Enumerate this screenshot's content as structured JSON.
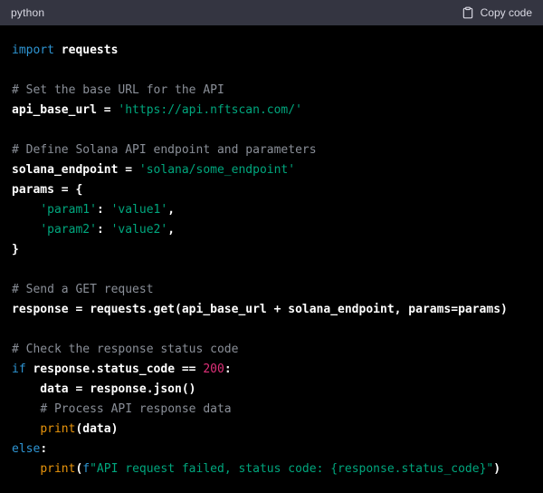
{
  "header": {
    "language": "python",
    "copy_label": "Copy code",
    "copy_icon": "clipboard-icon"
  },
  "colors": {
    "header_bg": "#343541",
    "header_fg": "#d9d9e3",
    "code_bg": "#000000",
    "plain": "#ffffff",
    "keyword": "#2e95d3",
    "string": "#00a67d",
    "number": "#df3079",
    "builtin": "#e9950c",
    "comment": "#8a8f98"
  },
  "code": {
    "lines": [
      [
        {
          "t": "kw",
          "v": "import"
        },
        {
          "t": "p",
          "v": " requests"
        }
      ],
      [],
      [
        {
          "t": "com",
          "v": "# Set the base URL for the API"
        }
      ],
      [
        {
          "t": "p",
          "v": "api_base_url = "
        },
        {
          "t": "str",
          "v": "'https://api.nftscan.com/'"
        }
      ],
      [],
      [
        {
          "t": "com",
          "v": "# Define Solana API endpoint and parameters"
        }
      ],
      [
        {
          "t": "p",
          "v": "solana_endpoint = "
        },
        {
          "t": "str",
          "v": "'solana/some_endpoint'"
        }
      ],
      [
        {
          "t": "p",
          "v": "params = {"
        }
      ],
      [
        {
          "t": "p",
          "v": "    "
        },
        {
          "t": "str",
          "v": "'param1'"
        },
        {
          "t": "p",
          "v": ": "
        },
        {
          "t": "str",
          "v": "'value1'"
        },
        {
          "t": "p",
          "v": ","
        }
      ],
      [
        {
          "t": "p",
          "v": "    "
        },
        {
          "t": "str",
          "v": "'param2'"
        },
        {
          "t": "p",
          "v": ": "
        },
        {
          "t": "str",
          "v": "'value2'"
        },
        {
          "t": "p",
          "v": ","
        }
      ],
      [
        {
          "t": "p",
          "v": "}"
        }
      ],
      [],
      [
        {
          "t": "com",
          "v": "# Send a GET request"
        }
      ],
      [
        {
          "t": "p",
          "v": "response = requests.get(api_base_url + solana_endpoint, params=params)"
        }
      ],
      [],
      [
        {
          "t": "com",
          "v": "# Check the response status code"
        }
      ],
      [
        {
          "t": "kw",
          "v": "if"
        },
        {
          "t": "p",
          "v": " response.status_code == "
        },
        {
          "t": "num",
          "v": "200"
        },
        {
          "t": "p",
          "v": ":"
        }
      ],
      [
        {
          "t": "p",
          "v": "    data = response.json()"
        }
      ],
      [
        {
          "t": "p",
          "v": "    "
        },
        {
          "t": "com",
          "v": "# Process API response data"
        }
      ],
      [
        {
          "t": "p",
          "v": "    "
        },
        {
          "t": "fn",
          "v": "print"
        },
        {
          "t": "p",
          "v": "(data)"
        }
      ],
      [
        {
          "t": "kw",
          "v": "else"
        },
        {
          "t": "p",
          "v": ":"
        }
      ],
      [
        {
          "t": "p",
          "v": "    "
        },
        {
          "t": "fn",
          "v": "print"
        },
        {
          "t": "p",
          "v": "("
        },
        {
          "t": "kw",
          "v": "f"
        },
        {
          "t": "str",
          "v": "\"API request failed, status code: {response.status_code}\""
        },
        {
          "t": "p",
          "v": ")"
        }
      ]
    ]
  }
}
